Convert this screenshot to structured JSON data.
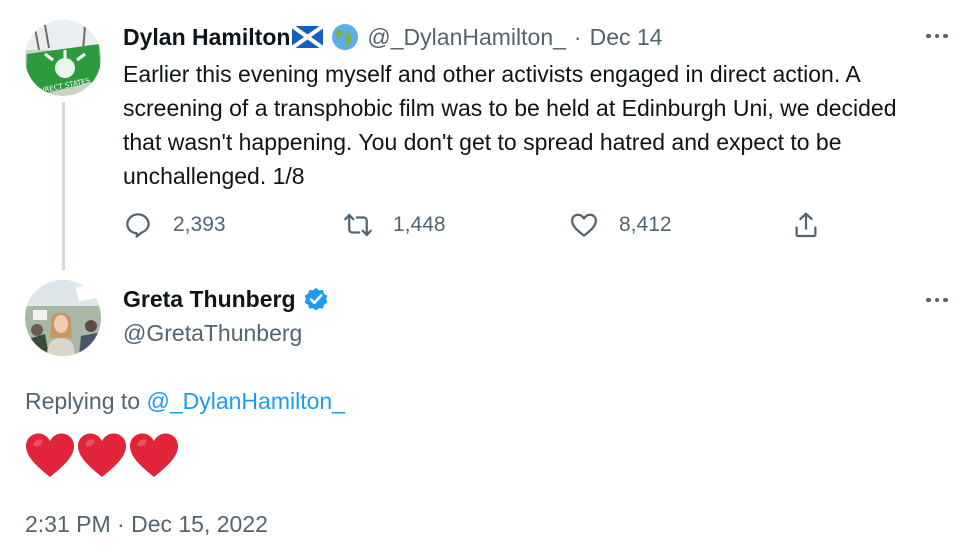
{
  "parent_tweet": {
    "author_name": "Dylan Hamilton",
    "handle": "@_DylanHamilton_",
    "separator": "·",
    "date": "Dec 14",
    "text_lines": [
      "Earlier this evening myself and other activists engaged in direct action. A",
      "screening of a transphobic film was to be held at Edinburgh Uni, we decided",
      "that wasn't happening. You don't get to spread hatred and expect to be",
      "unchallenged. 1/8"
    ],
    "avatar_caption": "DIRECT STATES",
    "replies": "2,393",
    "retweets": "1,448",
    "likes": "8,412"
  },
  "reply_tweet": {
    "author_name": "Greta Thunberg",
    "handle": "@GretaThunberg",
    "replying_prefix": "Replying to",
    "replying_to": "@_DylanHamilton_",
    "timestamp": "2:31 PM · Dec 15, 2022",
    "hearts_count": 3
  },
  "icons": {
    "reply": "reply-icon",
    "retweet": "retweet-icon",
    "like": "like-icon",
    "share": "share-icon",
    "more": "more-icon",
    "verified": "verified-badge-icon",
    "flag": "scotland-flag-icon",
    "globe": "globe-icon",
    "heart": "red-heart-icon"
  },
  "colors": {
    "text": "#0f1419",
    "secondary": "#536471",
    "link": "#1d9bf0",
    "heart": "#e0243a",
    "thread_line": "#cfd9de"
  }
}
